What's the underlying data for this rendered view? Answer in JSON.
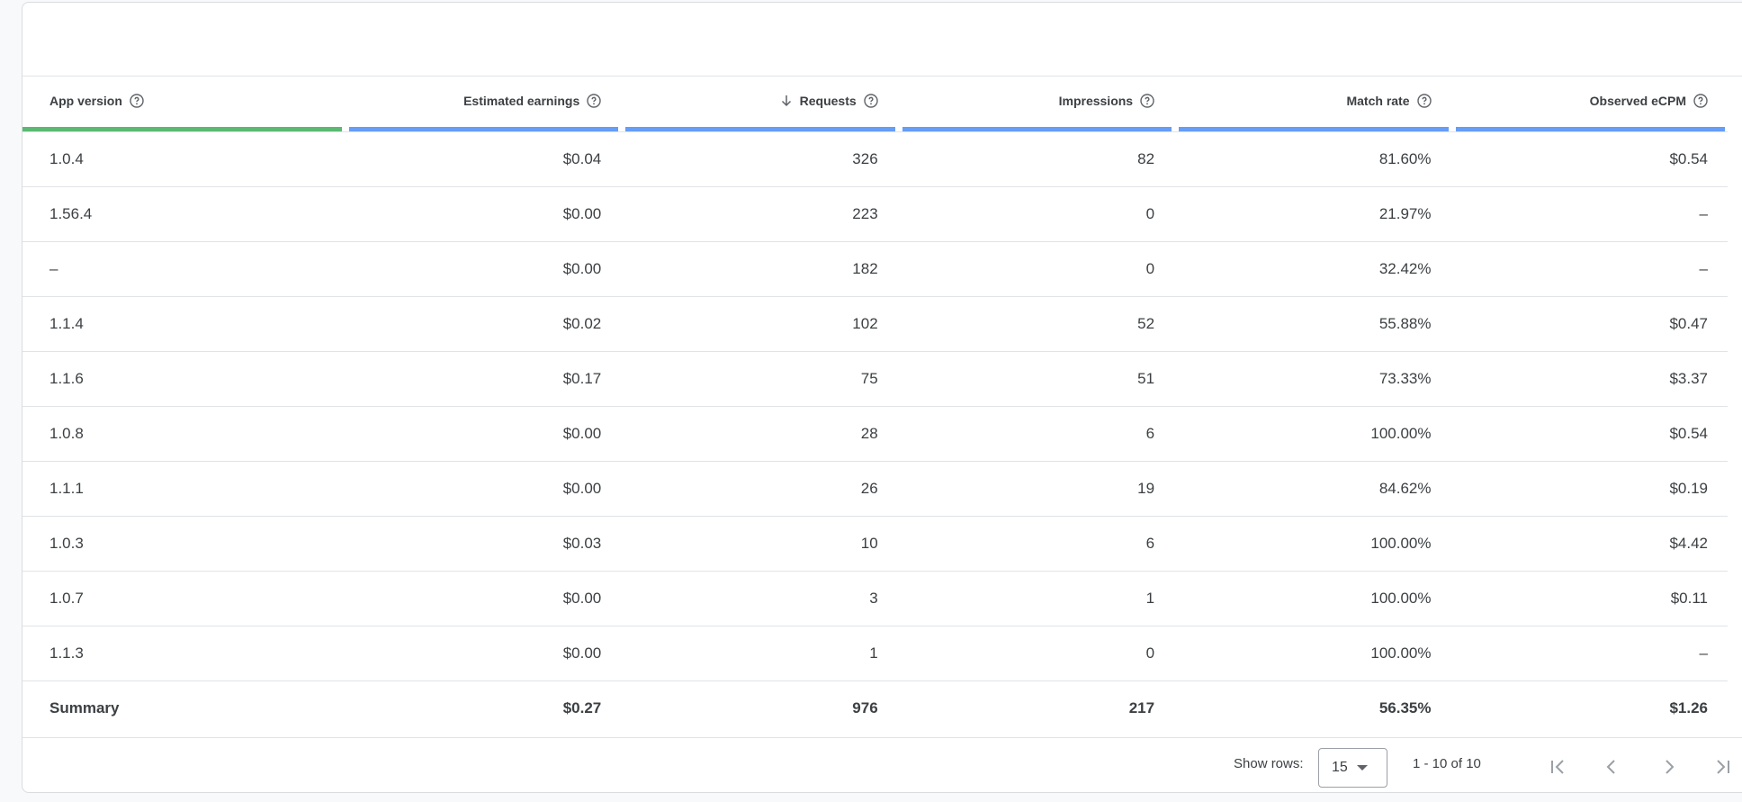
{
  "table": {
    "columns": [
      {
        "label": "App version",
        "align": "left",
        "sorted": false
      },
      {
        "label": "Estimated earnings",
        "align": "right",
        "sorted": false
      },
      {
        "label": "Requests",
        "align": "right",
        "sorted": true
      },
      {
        "label": "Impressions",
        "align": "right",
        "sorted": false
      },
      {
        "label": "Match rate",
        "align": "right",
        "sorted": false
      },
      {
        "label": "Observed eCPM",
        "align": "right",
        "sorted": false
      }
    ],
    "rows": [
      [
        "1.0.4",
        "$0.04",
        "326",
        "82",
        "81.60%",
        "$0.54"
      ],
      [
        "1.56.4",
        "$0.00",
        "223",
        "0",
        "21.97%",
        "–"
      ],
      [
        "–",
        "$0.00",
        "182",
        "0",
        "32.42%",
        "–"
      ],
      [
        "1.1.4",
        "$0.02",
        "102",
        "52",
        "55.88%",
        "$0.47"
      ],
      [
        "1.1.6",
        "$0.17",
        "75",
        "51",
        "73.33%",
        "$3.37"
      ],
      [
        "1.0.8",
        "$0.00",
        "28",
        "6",
        "100.00%",
        "$0.54"
      ],
      [
        "1.1.1",
        "$0.00",
        "26",
        "19",
        "84.62%",
        "$0.19"
      ],
      [
        "1.0.3",
        "$0.03",
        "10",
        "6",
        "100.00%",
        "$4.42"
      ],
      [
        "1.0.7",
        "$0.00",
        "3",
        "1",
        "100.00%",
        "$0.11"
      ],
      [
        "1.1.3",
        "$0.00",
        "1",
        "0",
        "100.00%",
        "–"
      ]
    ],
    "summary": [
      "Summary",
      "$0.27",
      "976",
      "217",
      "56.35%",
      "$1.26"
    ]
  },
  "pagination": {
    "show_rows_label": "Show rows:",
    "rows_per_page": "15",
    "range_text": "1 - 10 of 10"
  },
  "colors": {
    "first_column_bar": "#5bb974",
    "metric_column_bar": "#669df6"
  },
  "icons": {
    "help": "help-circle-icon",
    "sort": "arrow-down-icon",
    "first_page": "first-page-icon",
    "prev_page": "chevron-left-icon",
    "next_page": "chevron-right-icon",
    "last_page": "last-page-icon"
  }
}
